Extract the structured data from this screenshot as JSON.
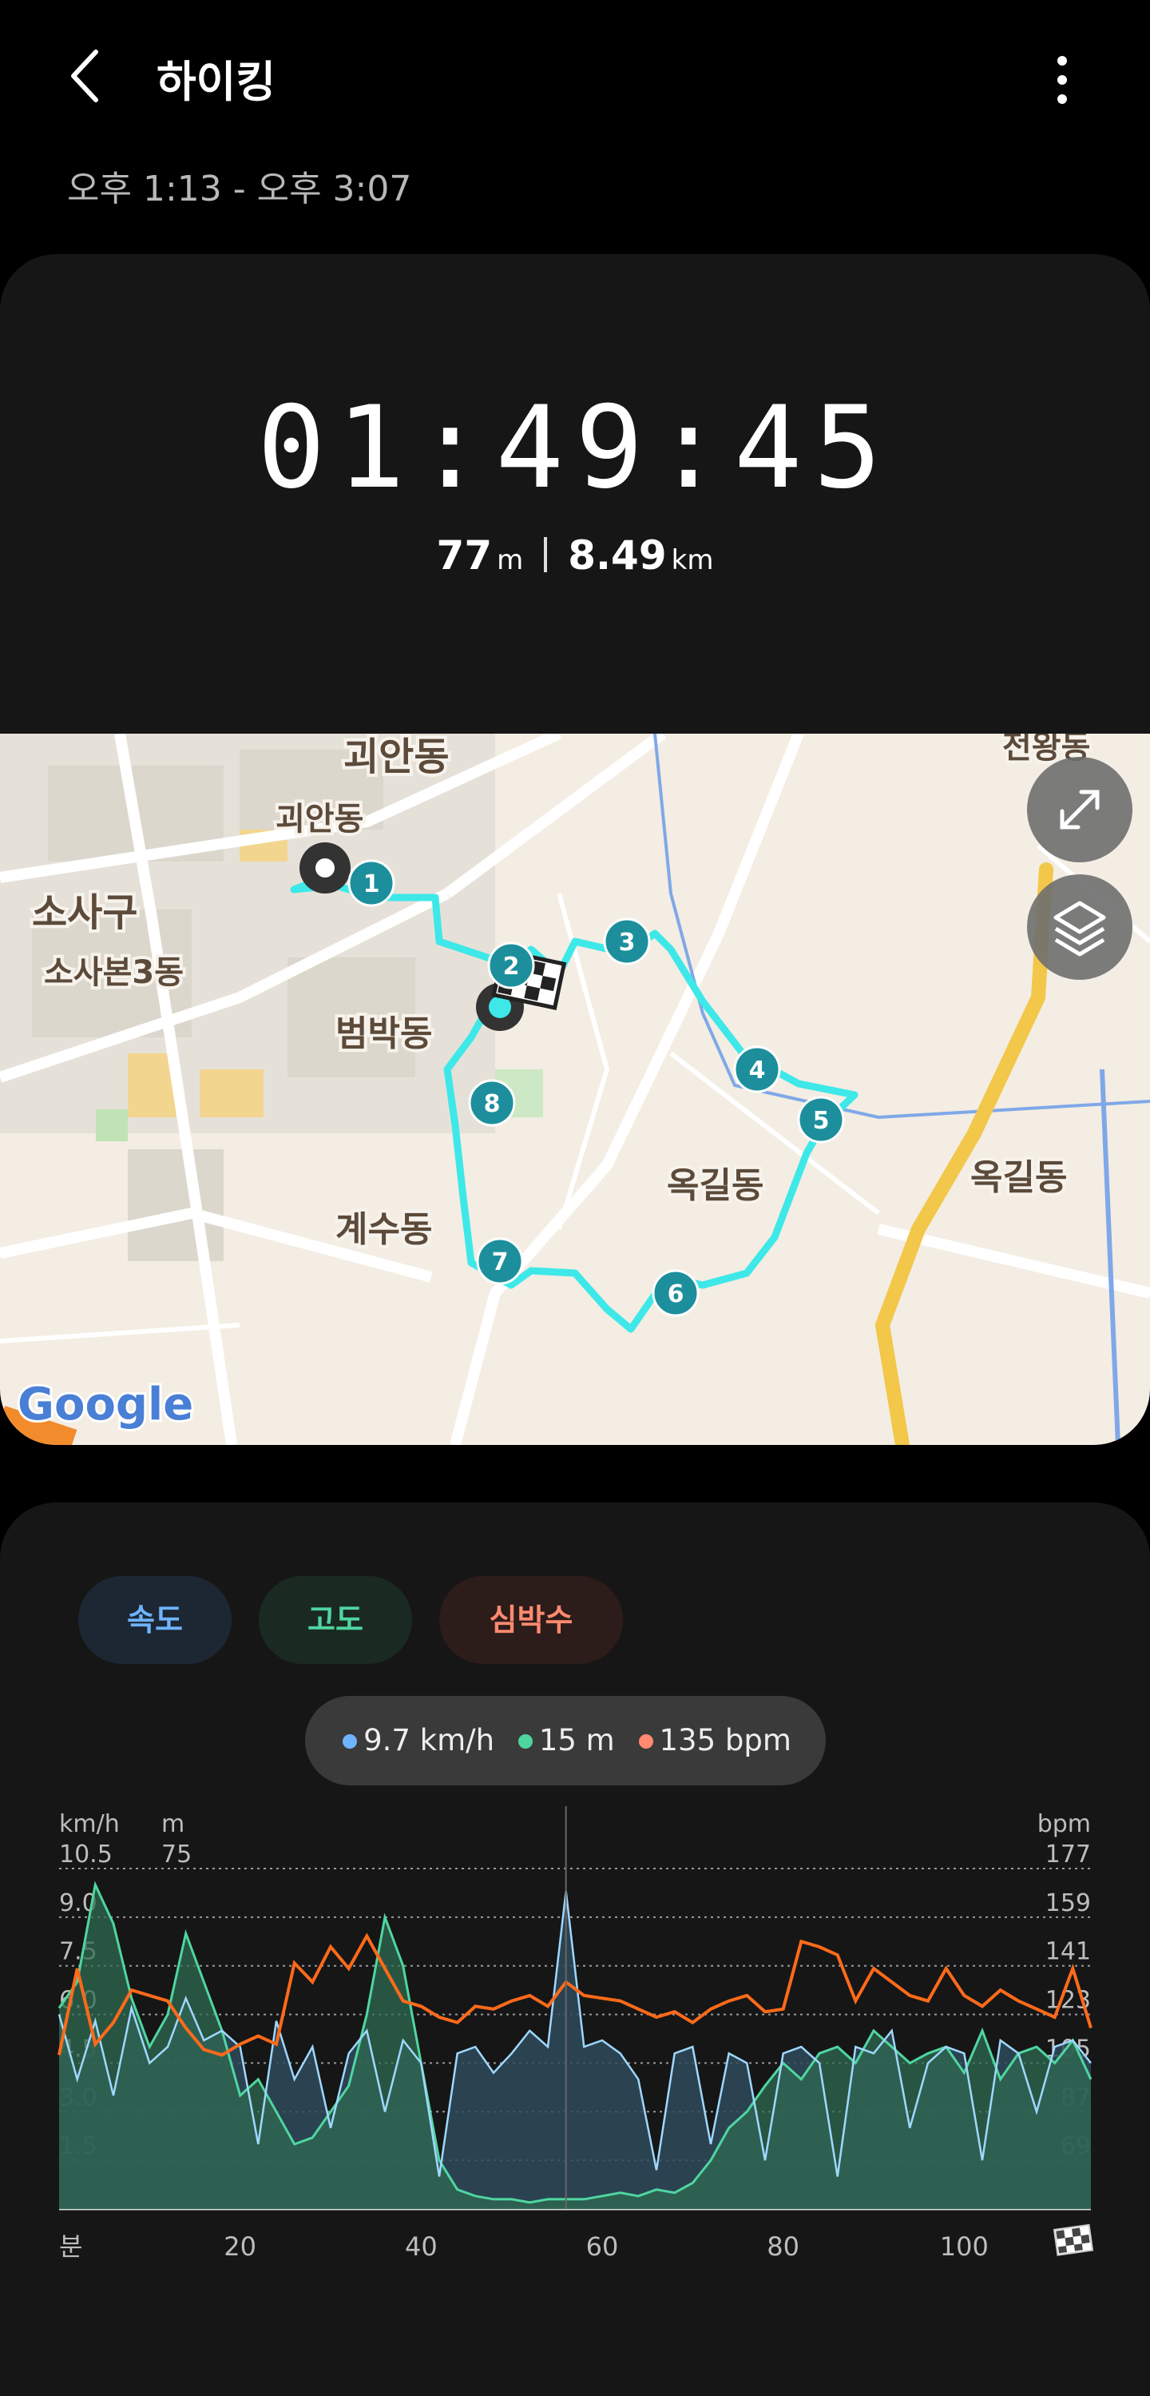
{
  "header": {
    "title": "하이킹",
    "time_range": "오후 1:13 - 오후 3:07"
  },
  "summary": {
    "duration": "01:49:45",
    "elevation_value": "77",
    "elevation_unit": "m",
    "distance_value": "8.49",
    "distance_unit": "km"
  },
  "map": {
    "labels": [
      "괴안동",
      "괴안동",
      "소사구",
      "소사본3동",
      "범박동",
      "계수동",
      "옥길동",
      "옥길동",
      "전왕동"
    ],
    "markers": [
      "1",
      "2",
      "3",
      "4",
      "5",
      "6",
      "7",
      "8"
    ],
    "attribution": "Google",
    "route_color": "#3ee8e8"
  },
  "tabs": [
    {
      "label": "속도",
      "color": "#6fb3ff",
      "bg": "#1c2733"
    },
    {
      "label": "고도",
      "color": "#4fd6a0",
      "bg": "#1a2a23"
    },
    {
      "label": "심박수",
      "color": "#ff8a70",
      "bg": "#2c1c1a"
    }
  ],
  "tooltip": {
    "speed": "9.7 km/h",
    "speed_color": "#6fb3ff",
    "altitude": "15 m",
    "altitude_color": "#4fd6a0",
    "heart": "135 bpm",
    "heart_color": "#ff8a70"
  },
  "chart_data": {
    "type": "area",
    "x_unit_label": "분",
    "x_ticks": [
      20,
      40,
      60,
      80,
      100
    ],
    "x_range": [
      0,
      114
    ],
    "y_left_unit": "km/h",
    "y_left2_unit": "m",
    "y_right_unit": "bpm",
    "y_left_ticks": [
      "10.5",
      "9.0",
      "7.5",
      "6.0",
      "4.5",
      "3.0",
      "1.5"
    ],
    "y_left_range": [
      0,
      10.5
    ],
    "y_left2_ticks": [
      "75"
    ],
    "y_right_ticks": [
      "177",
      "159",
      "141",
      "123",
      "105",
      "87",
      "69"
    ],
    "y_right_range": [
      51,
      177
    ],
    "cursor_x": 56,
    "series": [
      {
        "name": "속도",
        "color": "#9fd8ff",
        "fill": "#2f4a5c",
        "x": [
          0,
          2,
          4,
          6,
          8,
          10,
          12,
          14,
          16,
          18,
          20,
          22,
          24,
          26,
          28,
          30,
          32,
          34,
          36,
          38,
          40,
          42,
          44,
          46,
          48,
          50,
          52,
          54,
          56,
          58,
          60,
          62,
          64,
          66,
          68,
          70,
          72,
          74,
          76,
          78,
          80,
          82,
          84,
          86,
          88,
          90,
          92,
          94,
          96,
          98,
          100,
          102,
          104,
          106,
          108,
          110,
          112,
          114
        ],
        "values": [
          6.0,
          4.0,
          5.8,
          3.5,
          6.2,
          4.5,
          5.0,
          6.5,
          5.2,
          5.5,
          5.0,
          2.0,
          5.8,
          4.0,
          5.0,
          2.5,
          4.8,
          5.5,
          3.0,
          5.2,
          4.5,
          1.0,
          4.8,
          5.0,
          4.2,
          4.8,
          5.5,
          5.0,
          9.8,
          5.0,
          5.2,
          4.8,
          4.0,
          1.2,
          4.8,
          5.0,
          2.0,
          4.8,
          4.5,
          1.5,
          4.8,
          5.0,
          4.5,
          1.0,
          5.0,
          4.8,
          5.5,
          2.5,
          4.5,
          5.0,
          4.8,
          1.5,
          5.2,
          4.8,
          3.0,
          5.0,
          5.2,
          4.5
        ]
      },
      {
        "name": "고도",
        "color": "#4fd6a0",
        "fill": "#2f6b52",
        "x": [
          0,
          2,
          4,
          6,
          8,
          10,
          12,
          14,
          16,
          18,
          20,
          22,
          24,
          26,
          28,
          30,
          32,
          34,
          36,
          38,
          40,
          42,
          44,
          46,
          48,
          50,
          52,
          54,
          56,
          58,
          60,
          62,
          64,
          66,
          68,
          70,
          72,
          74,
          76,
          78,
          80,
          82,
          84,
          86,
          88,
          90,
          92,
          94,
          96,
          98,
          100,
          102,
          104,
          106,
          108,
          110,
          112,
          114
        ],
        "values": [
          6.2,
          7.0,
          10.0,
          8.8,
          6.5,
          5.0,
          6.0,
          8.5,
          7.0,
          5.5,
          3.5,
          4.0,
          3.0,
          2.0,
          2.2,
          3.0,
          3.8,
          6.0,
          9.0,
          7.5,
          4.5,
          1.5,
          0.6,
          0.4,
          0.3,
          0.3,
          0.2,
          0.3,
          0.3,
          0.3,
          0.4,
          0.5,
          0.4,
          0.6,
          0.5,
          0.8,
          1.5,
          2.5,
          3.0,
          3.8,
          4.5,
          4.0,
          4.8,
          5.0,
          4.5,
          5.5,
          5.0,
          4.5,
          4.8,
          5.0,
          4.2,
          5.5,
          4.0,
          4.8,
          5.0,
          4.5,
          5.2,
          4.0
        ]
      },
      {
        "name": "심박수",
        "color": "#ff6a1a",
        "x": [
          0,
          2,
          4,
          6,
          8,
          10,
          12,
          14,
          16,
          18,
          20,
          22,
          24,
          26,
          28,
          30,
          32,
          34,
          36,
          38,
          40,
          42,
          44,
          46,
          48,
          50,
          52,
          54,
          56,
          58,
          60,
          62,
          64,
          66,
          68,
          70,
          72,
          74,
          76,
          78,
          80,
          82,
          84,
          86,
          88,
          90,
          92,
          94,
          96,
          98,
          100,
          102,
          104,
          106,
          108,
          110,
          112,
          114
        ],
        "values": [
          108,
          140,
          112,
          120,
          132,
          130,
          128,
          118,
          110,
          108,
          112,
          115,
          112,
          142,
          135,
          148,
          140,
          152,
          140,
          128,
          126,
          122,
          120,
          126,
          125,
          128,
          130,
          126,
          135,
          130,
          129,
          128,
          125,
          122,
          124,
          120,
          125,
          128,
          130,
          124,
          125,
          150,
          148,
          145,
          128,
          140,
          135,
          130,
          128,
          140,
          130,
          126,
          132,
          128,
          125,
          122,
          140,
          118
        ]
      }
    ]
  }
}
